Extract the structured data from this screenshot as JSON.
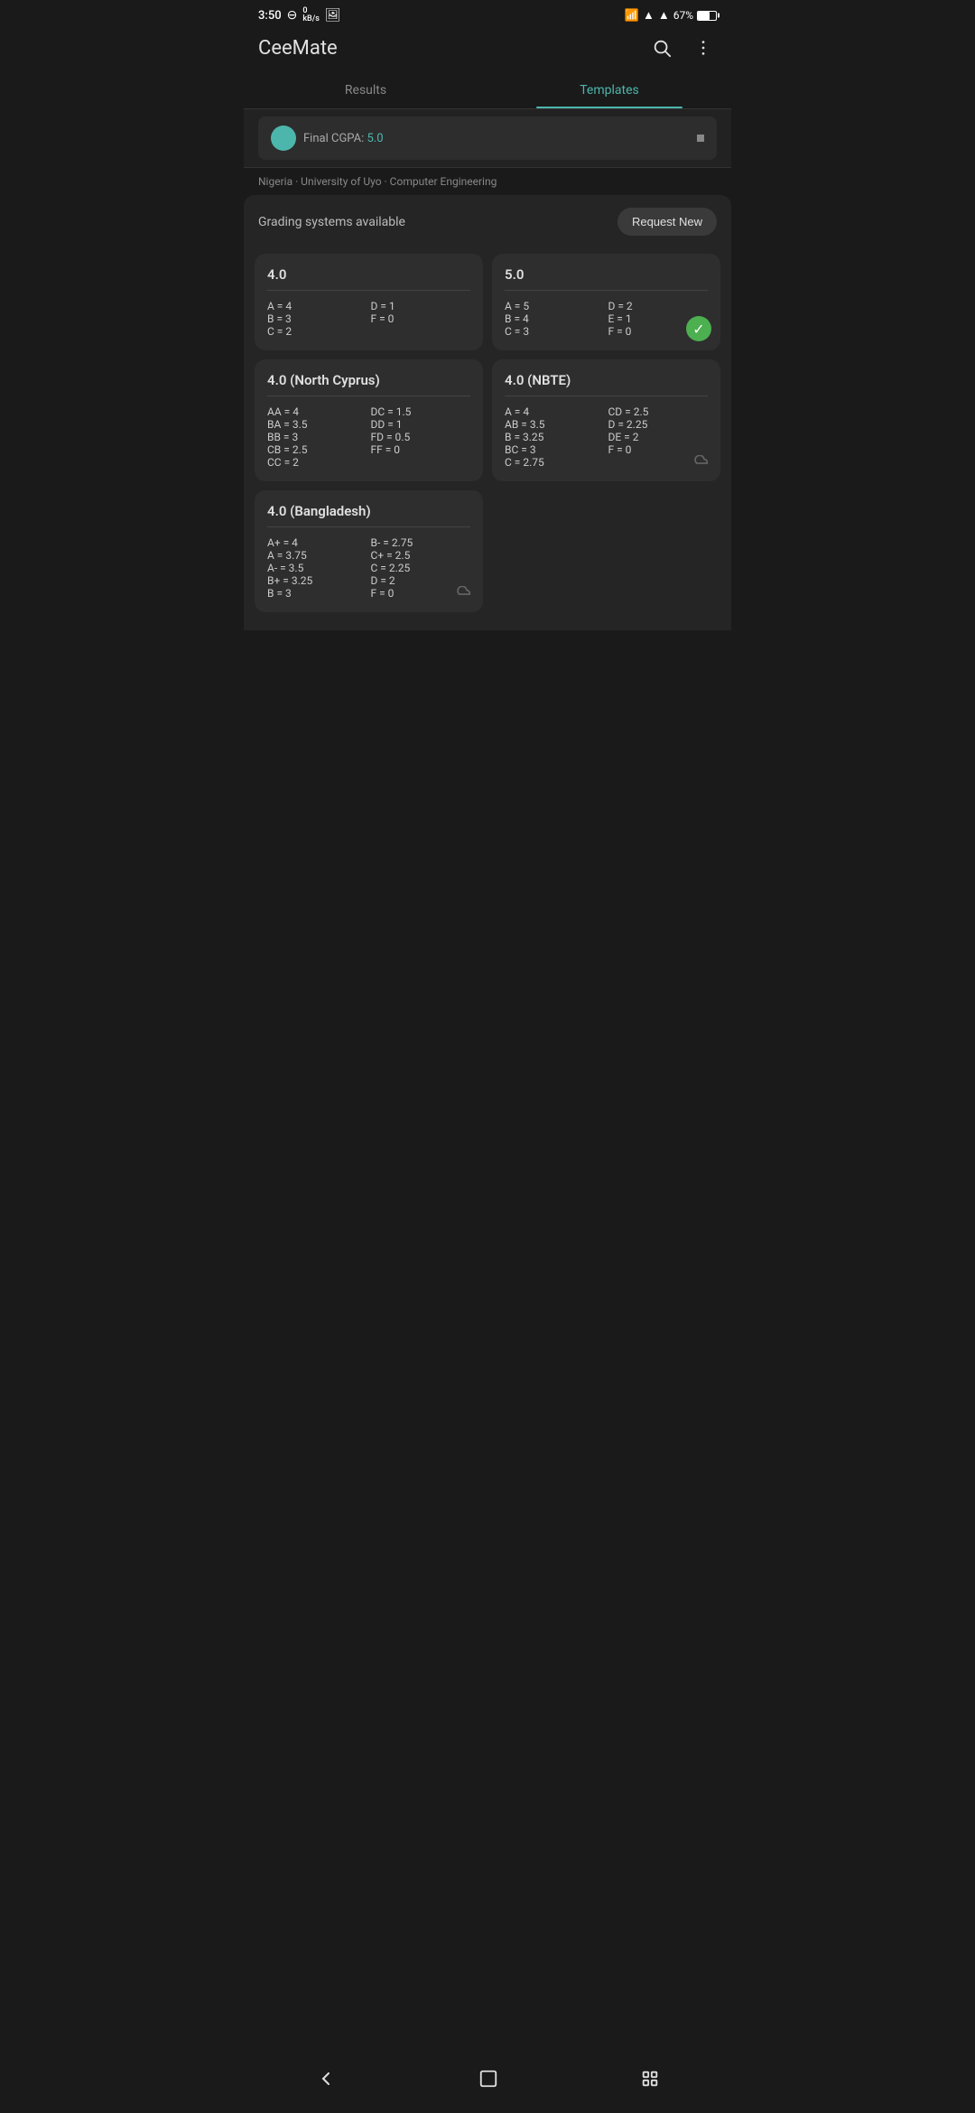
{
  "statusBar": {
    "time": "3:50",
    "battery": "67%",
    "batteryPercent": 67
  },
  "appBar": {
    "title": "CeeMate",
    "searchLabel": "Search",
    "menuLabel": "More options"
  },
  "tabs": [
    {
      "id": "results",
      "label": "Results",
      "active": false
    },
    {
      "id": "templates",
      "label": "Templates",
      "active": true
    }
  ],
  "breadcrumb": {
    "preview": "Final CGPA: 5.0",
    "location": "Nigeria · University of Uyo · Computer Engineering"
  },
  "gradingHeader": {
    "label": "Grading systems available",
    "requestBtn": "Request New"
  },
  "cards": [
    {
      "id": "4point0",
      "title": "4.0",
      "grades": [
        {
          "col": 1,
          "entries": [
            "A = 4",
            "B = 3",
            "C = 2"
          ]
        },
        {
          "col": 2,
          "entries": [
            "D = 1",
            "F = 0"
          ]
        }
      ],
      "selected": false,
      "cloud": false
    },
    {
      "id": "5point0",
      "title": "5.0",
      "grades": [
        {
          "col": 1,
          "entries": [
            "A = 5",
            "B = 4",
            "C = 3"
          ]
        },
        {
          "col": 2,
          "entries": [
            "D = 2",
            "E = 1",
            "F = 0"
          ]
        }
      ],
      "selected": true,
      "cloud": false
    },
    {
      "id": "4point0-northcyprus",
      "title": "4.0 (North Cyprus)",
      "grades": [
        {
          "col": 1,
          "entries": [
            "AA = 4",
            "BA = 3.5",
            "BB = 3",
            "CB = 2.5",
            "CC = 2"
          ]
        },
        {
          "col": 2,
          "entries": [
            "DC = 1.5",
            "DD = 1",
            "FD = 0.5",
            "FF = 0"
          ]
        }
      ],
      "selected": false,
      "cloud": false
    },
    {
      "id": "4point0-nbte",
      "title": "4.0 (NBTE)",
      "grades": [
        {
          "col": 1,
          "entries": [
            "A   = 4",
            "AB = 3.5",
            "B   = 3.25",
            "BC = 3",
            "C   = 2.75"
          ]
        },
        {
          "col": 2,
          "entries": [
            "CD = 2.5",
            "D   = 2.25",
            "DE = 2",
            "F    = 0"
          ]
        }
      ],
      "selected": false,
      "cloud": true
    },
    {
      "id": "4point0-bangladesh",
      "title": "4.0 (Bangladesh)",
      "grades": [
        {
          "col": 1,
          "entries": [
            "A+ = 4",
            "A   = 3.75",
            "A- = 3.5",
            "B+ = 3.25",
            "B   = 3"
          ]
        },
        {
          "col": 2,
          "entries": [
            "B- = 2.75",
            "C+ = 2.5",
            "C   = 2.25",
            "D   = 2",
            "F    = 0"
          ]
        }
      ],
      "selected": false,
      "cloud": true
    }
  ],
  "bottomNav": {
    "back": "‹",
    "home": "⬜",
    "recents": "⦿"
  }
}
